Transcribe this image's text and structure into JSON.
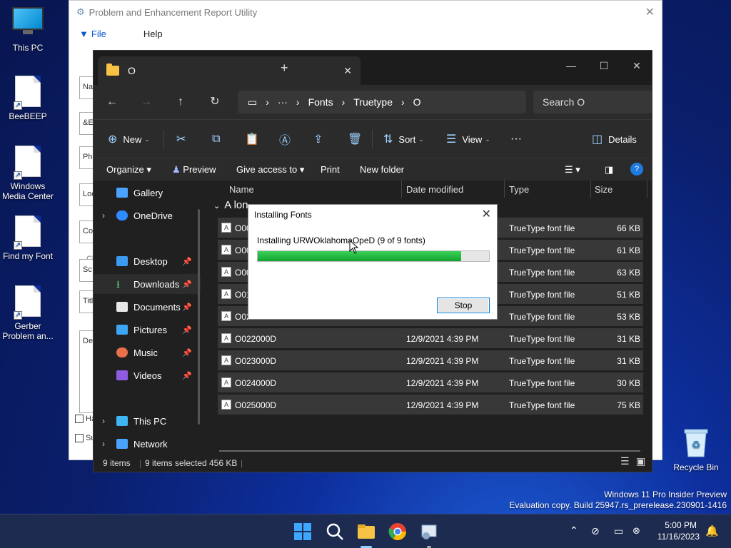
{
  "desktop": {
    "icons": [
      {
        "label": "This PC"
      },
      {
        "label": "BeeBEEP"
      },
      {
        "label": "Windows Media Center"
      },
      {
        "label": "Find my Font"
      },
      {
        "label": "Gerber Problem an..."
      },
      {
        "label": "Recycle Bin"
      }
    ]
  },
  "bgapp": {
    "title": "Problem and Enhancement Report Utility",
    "menu": [
      "File",
      "Help"
    ],
    "fields": [
      "Na",
      "&E",
      "Pho",
      "Loc",
      "Cor",
      "Sc",
      "Title",
      "De",
      "Ha",
      "Su"
    ],
    "group_label": "Cl"
  },
  "explorer": {
    "tab_title": "O",
    "breadcrumb": [
      "Fonts",
      "Truetype",
      "O"
    ],
    "breadcrumb_more": "···",
    "search_placeholder": "Search O",
    "cmd": {
      "new": "New",
      "sort": "Sort",
      "view": "View",
      "more": "···",
      "details": "Details"
    },
    "legacy": {
      "organize": "Organize",
      "preview": "Preview",
      "give_access": "Give access to",
      "print": "Print",
      "new_folder": "New folder"
    },
    "nav": [
      {
        "label": "Gallery"
      },
      {
        "label": "OneDrive"
      },
      {
        "label": "Desktop"
      },
      {
        "label": "Downloads"
      },
      {
        "label": "Documents"
      },
      {
        "label": "Pictures"
      },
      {
        "label": "Music"
      },
      {
        "label": "Videos"
      },
      {
        "label": "This PC"
      },
      {
        "label": "Network"
      }
    ],
    "columns": {
      "name": "Name",
      "date": "Date modified",
      "type": "Type",
      "size": "Size"
    },
    "group_header": "A lon",
    "rows": [
      {
        "name": "O00",
        "date": "",
        "type": "TrueType font file",
        "size": "66 KB"
      },
      {
        "name": "O00",
        "date": "",
        "type": "TrueType font file",
        "size": "61 KB"
      },
      {
        "name": "O00",
        "date": "",
        "type": "TrueType font file",
        "size": "63 KB"
      },
      {
        "name": "O01",
        "date": "",
        "type": "TrueType font file",
        "size": "51 KB"
      },
      {
        "name": "O02",
        "date": "",
        "type": "TrueType font file",
        "size": "53 KB"
      },
      {
        "name": "O022000D",
        "date": "12/9/2021 4:39 PM",
        "type": "TrueType font file",
        "size": "31 KB"
      },
      {
        "name": "O023000D",
        "date": "12/9/2021 4:39 PM",
        "type": "TrueType font file",
        "size": "31 KB"
      },
      {
        "name": "O024000D",
        "date": "12/9/2021 4:39 PM",
        "type": "TrueType font file",
        "size": "30 KB"
      },
      {
        "name": "O025000D",
        "date": "12/9/2021 4:39 PM",
        "type": "TrueType font file",
        "size": "75 KB"
      }
    ],
    "status": {
      "items": "9 items",
      "selected": "9 items selected",
      "size": "456 KB"
    }
  },
  "dialog": {
    "title": "Installing Fonts",
    "message": "Installing URWOklahomaOpeD (9 of 9 fonts)",
    "progress": 0.88,
    "stop_label": "Stop"
  },
  "watermark": {
    "line1": "Windows 11 Pro Insider Preview",
    "line2": "Evaluation copy. Build 25947.rs_prerelease.230901-1416"
  },
  "taskbar": {
    "time": "5:00 PM",
    "date": "11/16/2023"
  },
  "colors": {
    "accent": "#0078d4",
    "progress": "#10a32f",
    "folder": "#f6c344"
  }
}
